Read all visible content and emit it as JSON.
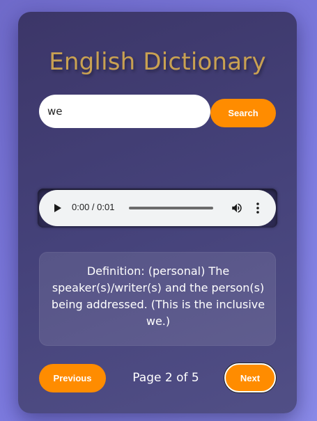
{
  "app": {
    "title": "English Dictionary"
  },
  "search": {
    "value": "we",
    "placeholder": "",
    "button_label": "Search"
  },
  "audio": {
    "time_display": "0:00 / 0:01",
    "current_time": "0:00",
    "duration": "0:01",
    "progress_fraction": 0,
    "icons": {
      "play": "play-icon",
      "volume": "volume-icon",
      "more": "more-vert-icon"
    }
  },
  "definition": {
    "text": "Definition: (personal) The speaker(s)/writer(s) and the person(s) being addressed. (This is the inclusive we.)"
  },
  "pagination": {
    "previous_label": "Previous",
    "page_text": "Page 2 of 5",
    "next_label": "Next"
  },
  "colors": {
    "accent": "#ff8c00",
    "title": "#c9a152",
    "card_background": "#45427a",
    "page_background": "#7d7be0"
  }
}
